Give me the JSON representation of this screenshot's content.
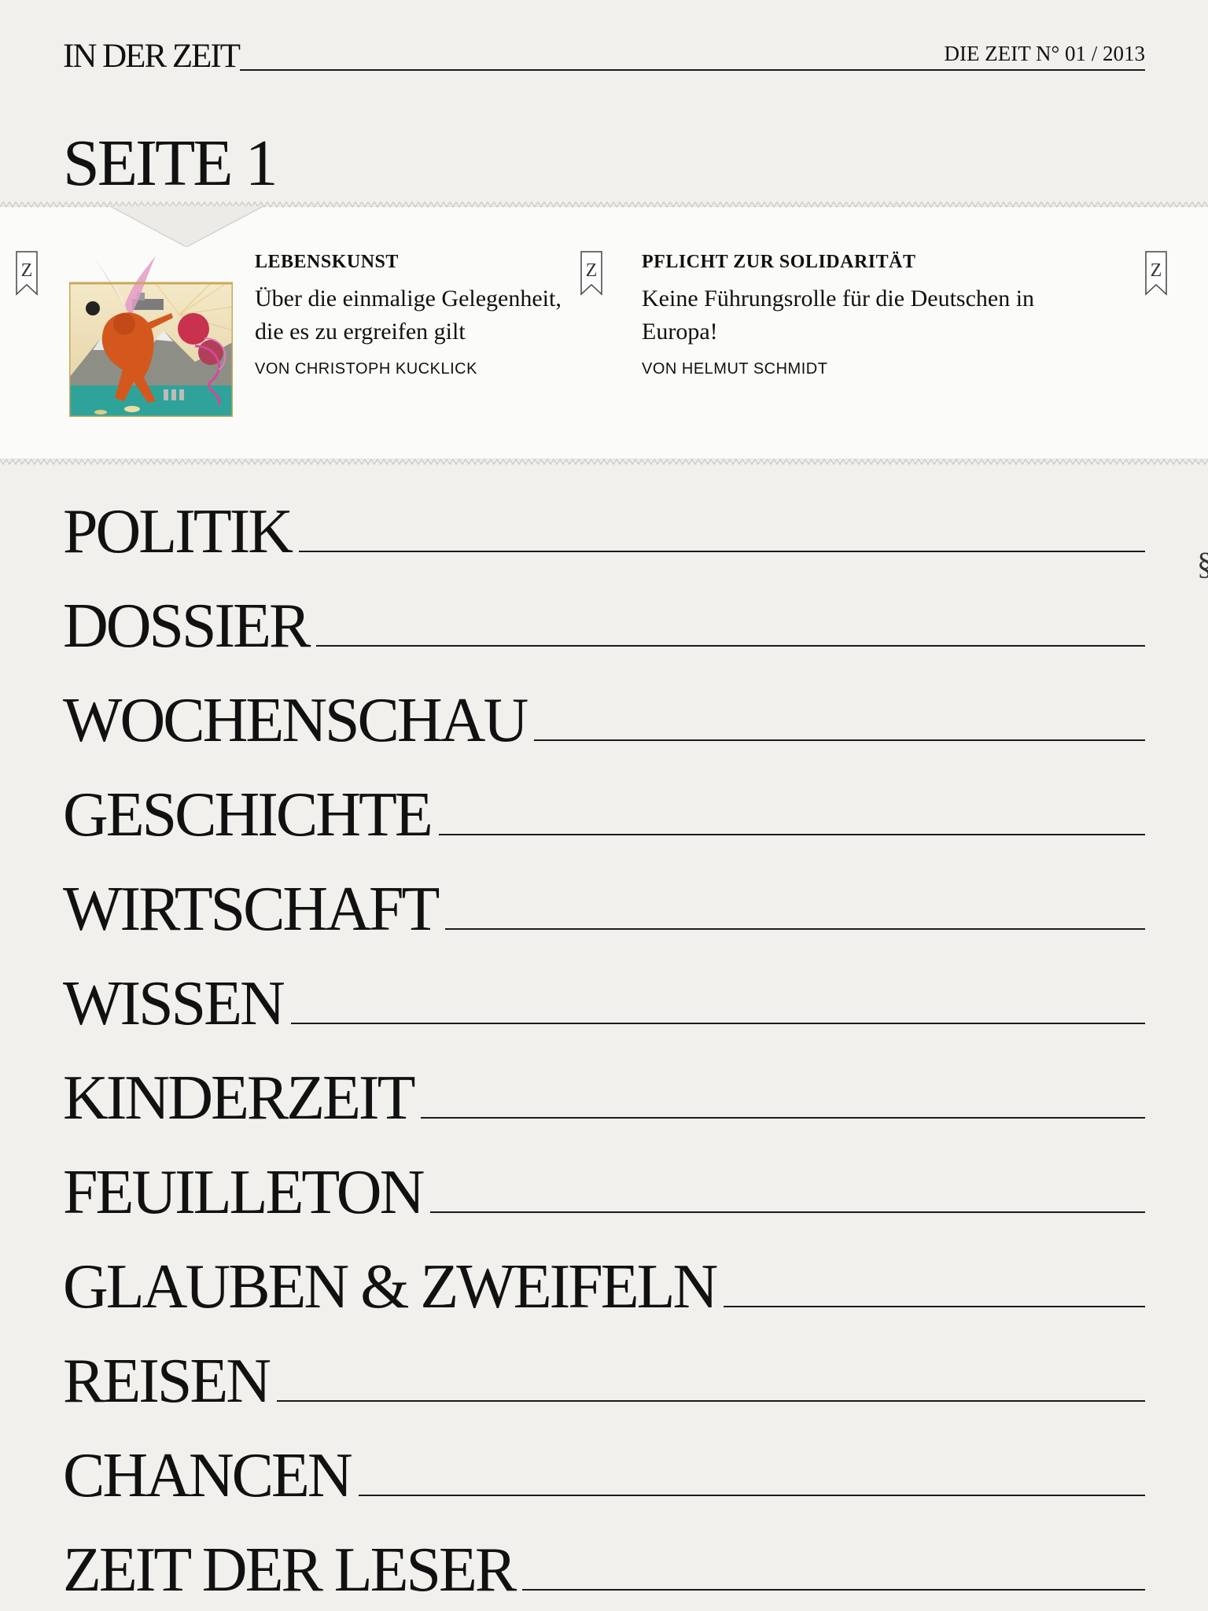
{
  "header": {
    "section_label": "IN DER ZEIT",
    "issue": "DIE ZEIT N° 01 / 2013"
  },
  "page_title": "SEITE 1",
  "teasers": [
    {
      "kicker": "LEBENSKUNST",
      "headline": "Über die einmalige Gelegenheit, die es zu ergreifen gilt",
      "author": "VON CHRISTOPH KUCKLICK",
      "bookmark_icon": "Z"
    },
    {
      "kicker": "PFLICHT ZUR SOLIDARITÄT",
      "headline": "Keine Führungsrolle für die Deutschen in Europa!",
      "author": "VON HELMUT SCHMIDT",
      "bookmark_icon": "Z"
    },
    {
      "bookmark_icon": "Z"
    }
  ],
  "sections": [
    "POLITIK",
    "DOSSIER",
    "WOCHENSCHAU",
    "GESCHICHTE",
    "WIRTSCHAFT",
    "WISSEN",
    "KINDERZEIT",
    "FEUILLETON",
    "GLAUBEN & ZWEIFELN",
    "REISEN",
    "CHANCEN",
    "ZEIT DER LESER"
  ],
  "colors": {
    "background": "#f1f0ed",
    "strip": "#fbfbf9",
    "text": "#111111"
  }
}
